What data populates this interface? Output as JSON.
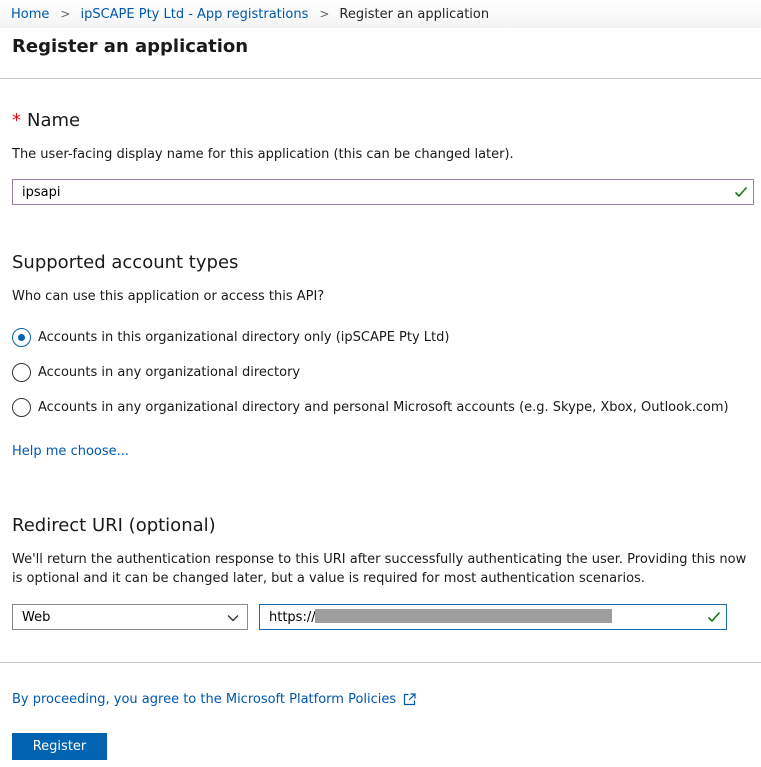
{
  "breadcrumb": {
    "home": "Home",
    "parent": "ipSCAPE Pty Ltd - App registrations",
    "current": "Register an application",
    "separator": ">"
  },
  "page": {
    "title": "Register an application"
  },
  "name_section": {
    "required_marker": "*",
    "title": "Name",
    "description": "The user-facing display name for this application (this can be changed later).",
    "value": "ipsapi"
  },
  "account_types": {
    "title": "Supported account types",
    "question": "Who can use this application or access this API?",
    "options": [
      {
        "label": "Accounts in this organizational directory only (ipSCAPE Pty Ltd)",
        "selected": true
      },
      {
        "label": "Accounts in any organizational directory",
        "selected": false
      },
      {
        "label": "Accounts in any organizational directory and personal Microsoft accounts (e.g. Skype, Xbox, Outlook.com)",
        "selected": false
      }
    ],
    "help_link": "Help me choose..."
  },
  "redirect": {
    "title": "Redirect URI (optional)",
    "description": "We'll return the authentication response to this URI after successfully authenticating the user. Providing this now is optional and it can be changed later, but a value is required for most authentication scenarios.",
    "platform": "Web",
    "uri_value": "https://c"
  },
  "footer": {
    "policy_link": "By proceeding, you agree to the Microsoft Platform Policies",
    "register_label": "Register"
  },
  "colors": {
    "accent": "#0063b1",
    "link": "#0058ad",
    "valid": "#107c10",
    "required": "#e00b1c"
  }
}
